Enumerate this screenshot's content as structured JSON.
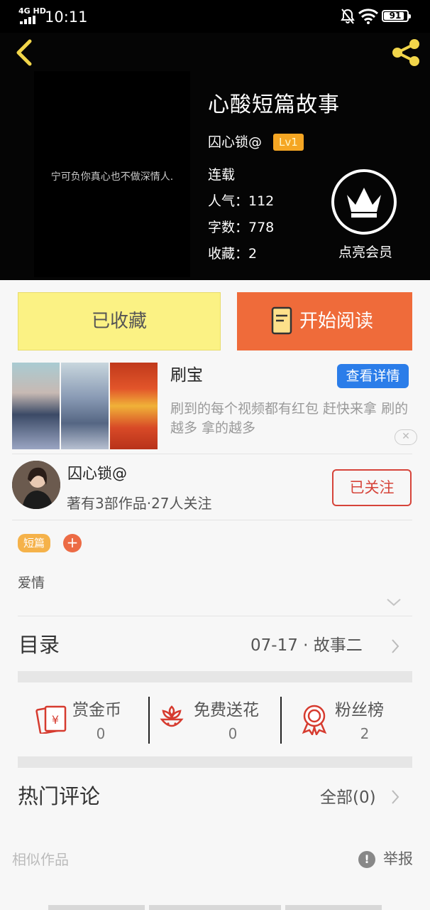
{
  "status_bar": {
    "network": "4G HD",
    "time": "10:11",
    "battery": "91"
  },
  "header": {
    "cover_text": "宁可负你真心也不做深情人.",
    "title": "心酸短篇故事",
    "author": "囚心锁@",
    "level": "Lv1",
    "status": "连载",
    "popularity": "人气：112",
    "word_count": "字数：778",
    "favorites": "收藏：2",
    "vip_label": "点亮会员"
  },
  "actions": {
    "collected": "已收藏",
    "start_reading": "开始阅读"
  },
  "ad": {
    "name": "刷宝",
    "cta": "查看详情",
    "description": "刷到的每个视频都有红包 赶快来拿 刷的越多 拿的越多",
    "close": "✕"
  },
  "author_card": {
    "name": "囚心锁@",
    "stats": "著有3部作品·27人关注",
    "follow": "已关注"
  },
  "tags": {
    "genre": "短篇",
    "add": "+"
  },
  "intro": "爱情",
  "catalog": {
    "label": "目录",
    "latest": "07-17 · 故事二"
  },
  "stats": [
    {
      "label": "赏金币",
      "value": "0",
      "icon": "red-envelope-icon"
    },
    {
      "label": "免费送花",
      "value": "0",
      "icon": "flower-icon"
    },
    {
      "label": "粉丝榜",
      "value": "2",
      "icon": "medal-icon"
    }
  ],
  "comments": {
    "label": "热门评论",
    "all": "全部(0)"
  },
  "footer": {
    "similar": "相似作品",
    "report": "举报",
    "report_icon": "!"
  },
  "colors": {
    "accent_orange": "#ef6b3a",
    "collected_yellow": "#fbf284",
    "follow_red": "#d6443a",
    "cta_blue": "#2b7de9",
    "level_gold": "#f5a623"
  }
}
